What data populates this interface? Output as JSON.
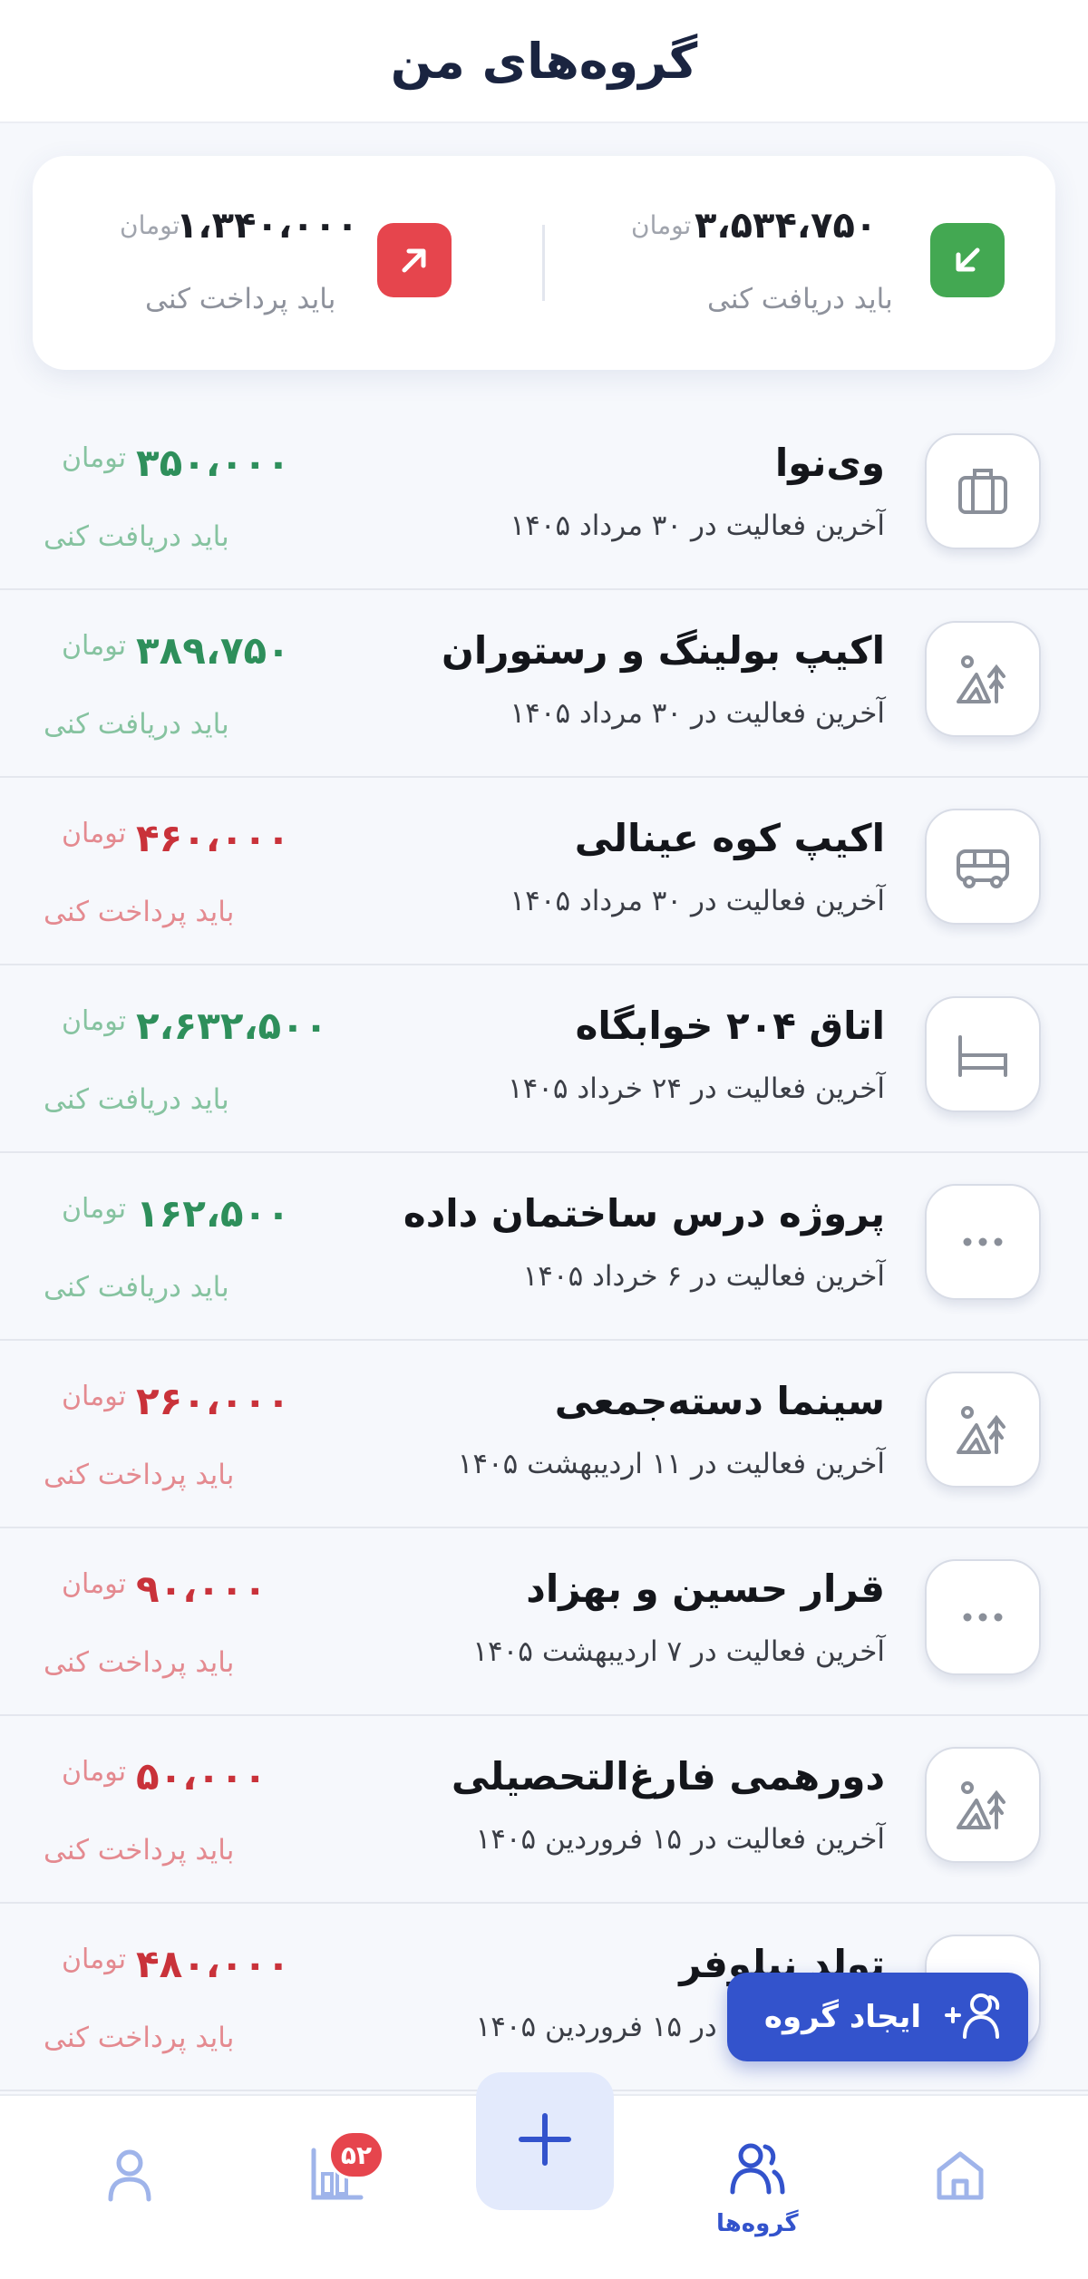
{
  "header": {
    "title": "گروه‌های من"
  },
  "summary": {
    "receive": {
      "amount": "۳،۵۳۴،۷۵۰",
      "unit": "تومان",
      "label": "باید دریافت کنی",
      "color": "#43a852"
    },
    "pay": {
      "amount": "۱،۳۴۰،۰۰۰",
      "unit": "تومان",
      "label": "باید پرداخت کنی",
      "color": "#e6454d"
    }
  },
  "groups": [
    {
      "name": "وی‌نوا",
      "last_activity": "آخرین فعالیت در ۳۰ مرداد ۱۴۰۵",
      "amount": "۳۵۰،۰۰۰",
      "unit": "تومان",
      "status": "باید دریافت کنی",
      "direction": "receive",
      "icon": "briefcase-icon"
    },
    {
      "name": "اکیپ بولینگ و رستوران",
      "last_activity": "آخرین فعالیت در ۳۰ مرداد ۱۴۰۵",
      "amount": "۳۸۹،۷۵۰",
      "unit": "تومان",
      "status": "باید دریافت کنی",
      "direction": "receive",
      "icon": "camping-icon"
    },
    {
      "name": "اکیپ کوه عینالی",
      "last_activity": "آخرین فعالیت در ۳۰ مرداد ۱۴۰۵",
      "amount": "۴۶۰،۰۰۰",
      "unit": "تومان",
      "status": "باید پرداخت کنی",
      "direction": "pay",
      "icon": "bus-icon"
    },
    {
      "name": "اتاق ۲۰۴ خوابگاه",
      "last_activity": "آخرین فعالیت در ۲۴ خرداد ۱۴۰۵",
      "amount": "۲،۶۳۲،۵۰۰",
      "unit": "تومان",
      "status": "باید دریافت کنی",
      "direction": "receive",
      "icon": "bed-icon"
    },
    {
      "name": "پروژه درس ساختمان داده",
      "last_activity": "آخرین فعالیت در ۶ خرداد ۱۴۰۵",
      "amount": "۱۶۲،۵۰۰",
      "unit": "تومان",
      "status": "باید دریافت کنی",
      "direction": "receive",
      "icon": "more-icon"
    },
    {
      "name": "سینما دسته‌جمعی",
      "last_activity": "آخرین فعالیت در ۱۱ اردیبهشت ۱۴۰۵",
      "amount": "۲۶۰،۰۰۰",
      "unit": "تومان",
      "status": "باید پرداخت کنی",
      "direction": "pay",
      "icon": "camping-icon"
    },
    {
      "name": "قرار حسین و بهزاد",
      "last_activity": "آخرین فعالیت در ۷ اردیبهشت ۱۴۰۵",
      "amount": "۹۰،۰۰۰",
      "unit": "تومان",
      "status": "باید پرداخت کنی",
      "direction": "pay",
      "icon": "more-icon"
    },
    {
      "name": "دورهمی فارغ‌التحصیلی",
      "last_activity": "آخرین فعالیت در ۱۵ فروردین ۱۴۰۵",
      "amount": "۵۰،۰۰۰",
      "unit": "تومان",
      "status": "باید پرداخت کنی",
      "direction": "pay",
      "icon": "camping-icon"
    },
    {
      "name": "تولد نیلوفر",
      "last_activity": "آخرین فعالیت در ۱۵ فروردین ۱۴۰۵",
      "amount": "۴۸۰،۰۰۰",
      "unit": "تومان",
      "status": "باید پرداخت کنی",
      "direction": "pay",
      "icon": "gift-icon"
    }
  ],
  "fab": {
    "label": "ایجاد گروه"
  },
  "bottom_nav": {
    "badge": "۵۲",
    "groups_label": "گروه‌ها",
    "accent": "#3353cc"
  }
}
